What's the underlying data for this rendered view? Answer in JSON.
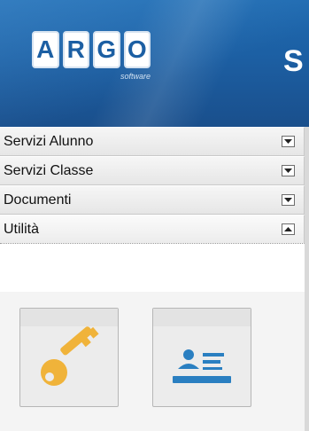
{
  "header": {
    "logo_letters": [
      "A",
      "R",
      "G",
      "O"
    ],
    "logo_subtitle": "software",
    "title_fragment": "S"
  },
  "menu": {
    "items": [
      {
        "label": "Servizi Alunno",
        "state": "collapsed",
        "toggle_icon": "chevron-down-icon"
      },
      {
        "label": "Servizi Classe",
        "state": "collapsed",
        "toggle_icon": "chevron-down-icon"
      },
      {
        "label": "Documenti",
        "state": "collapsed",
        "toggle_icon": "chevron-down-icon"
      },
      {
        "label": "Utilità",
        "state": "expanded",
        "toggle_icon": "chevron-up-icon"
      }
    ]
  },
  "utility_tiles": [
    {
      "icon": "key-icon",
      "color": "#f0b33a"
    },
    {
      "icon": "contact-card-icon",
      "color": "#2a7fc1"
    }
  ],
  "colors": {
    "header_blue": "#1c5fa3",
    "key_orange": "#f0b33a",
    "card_blue": "#2a7fc1"
  }
}
